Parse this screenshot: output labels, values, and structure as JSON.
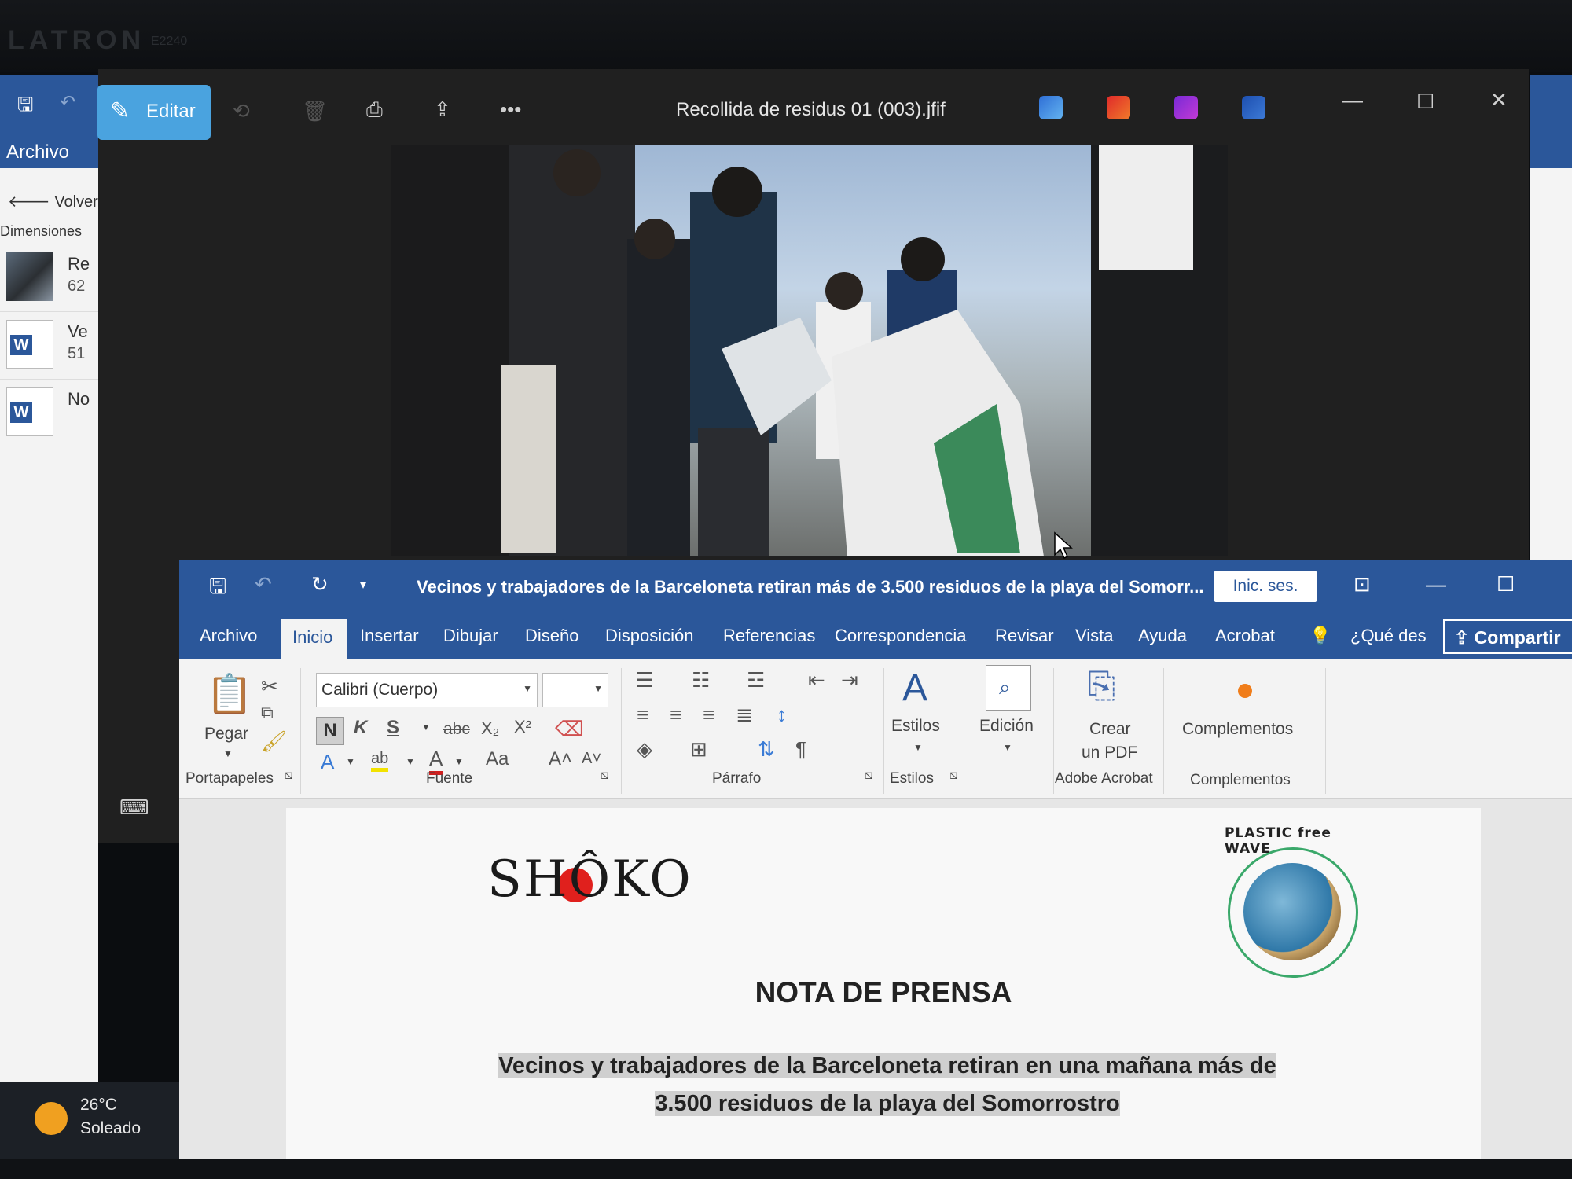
{
  "bezel": {
    "brand": "LATRON",
    "model": "E2240"
  },
  "background_window": {
    "menu_archivo": "Archivo",
    "back_label": "Volver",
    "dimensions_label": "Dimensiones",
    "files": [
      {
        "name": "Re",
        "size": "62"
      },
      {
        "name": "Ve",
        "size": "51"
      },
      {
        "name": "No",
        "size": ""
      }
    ]
  },
  "weather": {
    "temperature": "26°C",
    "condition": "Soleado"
  },
  "viewer": {
    "edit_label": "Editar",
    "title": "Recollida de residus 01 (003).jfif",
    "more_label": "•••"
  },
  "word": {
    "title": "Vecinos y trabajadores de la Barceloneta retiran más de 3.500 residuos de la playa del Somorr...",
    "signin": "Inic. ses.",
    "tabs": [
      "Archivo",
      "Inicio",
      "Insertar",
      "Dibujar",
      "Diseño",
      "Disposición",
      "Referencias",
      "Correspondencia",
      "Revisar",
      "Vista",
      "Ayuda",
      "Acrobat"
    ],
    "active_tab": "Inicio",
    "tellme": "¿Qué des",
    "share": "Compartir",
    "ribbon": {
      "paste": "Pegar",
      "clipboard_group": "Portapapeles",
      "font_name": "Calibri (Cuerpo)",
      "bold": "N",
      "italic": "K",
      "underline": "S",
      "strike": "abc",
      "subscript": "X₂",
      "superscript": "X²",
      "case": "Aa",
      "grow": "A˄",
      "shrink": "A˅",
      "font_group": "Fuente",
      "paragraph_group": "Párrafo",
      "styles": "Estilos",
      "styles_group": "Estilos",
      "editing": "Edición",
      "create_pdf_line1": "Crear",
      "create_pdf_line2": "un PDF",
      "acrobat_group": "Adobe Acrobat",
      "addins": "Complementos",
      "addins_group": "Complementos"
    },
    "document": {
      "logo": "SHÔKO",
      "badge": "PLASTIC free WAVE",
      "heading": "NOTA DE PRENSA",
      "subtitle_line1": "Vecinos y trabajadores de la Barceloneta retiran en una mañana más de",
      "subtitle_line2": "3.500 residuos de la playa del Somorrostro"
    }
  }
}
